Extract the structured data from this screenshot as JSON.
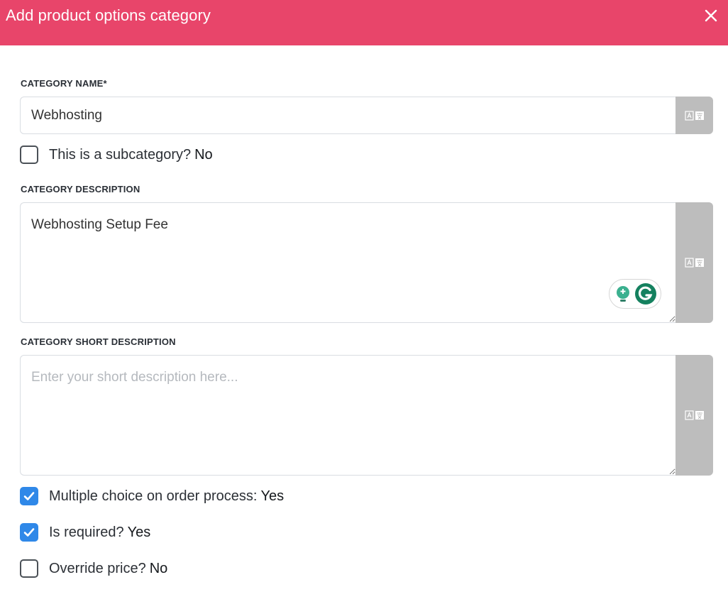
{
  "header": {
    "title": "Add product options category"
  },
  "category_name": {
    "label": "CATEGORY NAME*",
    "value": "Webhosting"
  },
  "subcategory": {
    "label": "This is a subcategory?",
    "value": "No",
    "checked": false
  },
  "category_description": {
    "label": "CATEGORY DESCRIPTION",
    "value": "Webhosting Setup Fee"
  },
  "category_short_description": {
    "label": "CATEGORY SHORT DESCRIPTION",
    "value": "",
    "placeholder": "Enter your short description here..."
  },
  "multiple_choice": {
    "label": "Multiple choice on order process:",
    "value": "Yes",
    "checked": true
  },
  "is_required": {
    "label": "Is required?",
    "value": "Yes",
    "checked": true
  },
  "override_price": {
    "label": "Override price?",
    "value": "No",
    "checked": false
  },
  "colors": {
    "header": "#e8456a",
    "checkbox_checked": "#2f88e8",
    "translate_button": "#bdbdbd"
  },
  "icons": {
    "close": "close-icon",
    "translate": "translate-icon",
    "grammarly": "grammarly-icon"
  }
}
